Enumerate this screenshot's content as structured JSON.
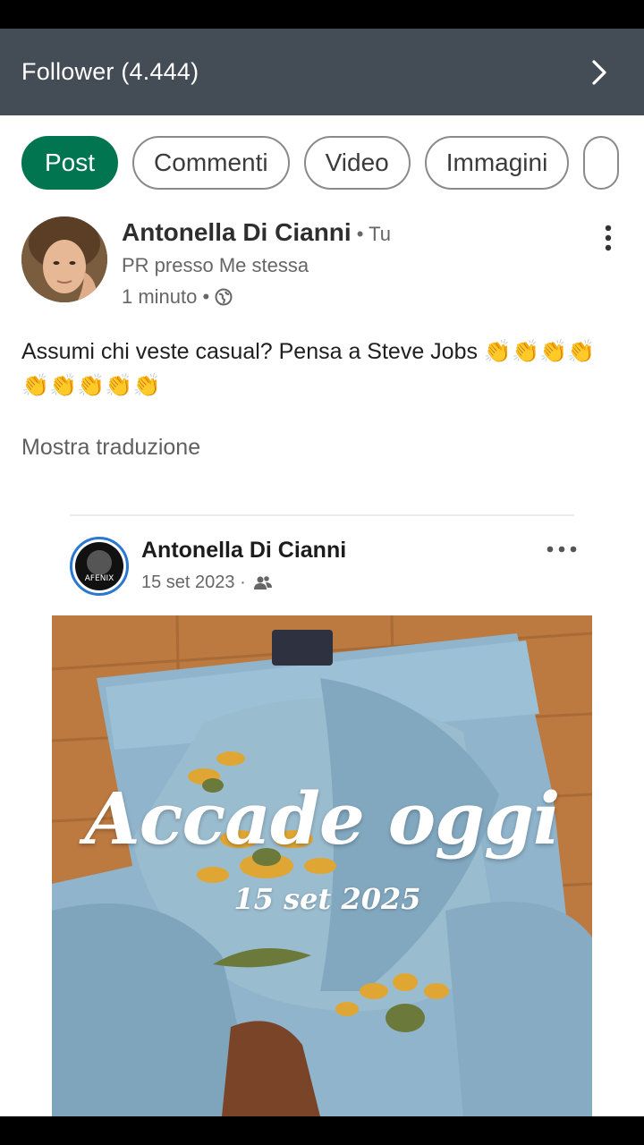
{
  "header": {
    "title": "Follower (4.444)",
    "chevron_icon": "chevron-right-icon"
  },
  "tabs": [
    {
      "label": "Post",
      "active": true
    },
    {
      "label": "Commenti",
      "active": false
    },
    {
      "label": "Video",
      "active": false
    },
    {
      "label": "Immagini",
      "active": false
    }
  ],
  "post": {
    "author": "Antonella Di Cianni",
    "you_badge": "• Tu",
    "headline": "PR presso Me stessa",
    "time": "1 minuto •",
    "visibility_icon": "globe-icon",
    "text": "Assumi chi veste casual? Pensa a Steve Jobs 👏👏👏👏👏👏👏👏👏",
    "translate_label": "Mostra traduzione",
    "more_icon": "kebab-menu-icon"
  },
  "shared": {
    "author": "Antonella Di Cianni",
    "date": "15 set 2023 ·",
    "audience_icon": "friends-icon",
    "avatar_text": "AFENIX",
    "more_icon": "more-horizontal-icon",
    "image": {
      "title": "Accade oggi",
      "date": "15 set 2025"
    }
  },
  "colors": {
    "header_bg": "#444c55",
    "tab_active": "#01754f",
    "accent_blue": "#2a78d0"
  }
}
